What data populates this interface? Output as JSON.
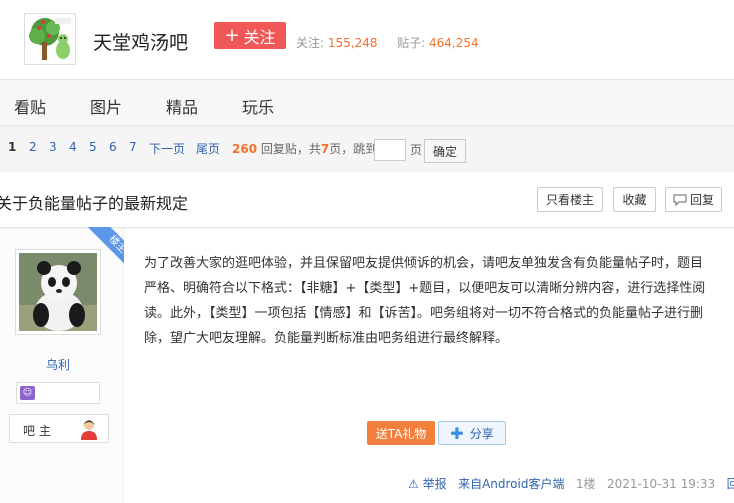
{
  "header": {
    "forum_name": "天堂鸡汤吧",
    "follow_label": "关注",
    "follow_prefix": "+",
    "followers_label": "关注:",
    "followers_count": "155,248",
    "posts_label": "贴子:",
    "posts_count": "464,254"
  },
  "nav": {
    "tabs": [
      {
        "label": "看贴"
      },
      {
        "label": "图片"
      },
      {
        "label": "精品"
      },
      {
        "label": "玩乐"
      }
    ]
  },
  "pager": {
    "pages": [
      "1",
      "2",
      "3",
      "4",
      "5",
      "6",
      "7"
    ],
    "current": "1",
    "next_label": "下一页",
    "last_label": "尾页",
    "reply_count": "260",
    "reply_suffix": "回复贴，共",
    "total_pages": "7",
    "pages_suffix": "页，跳到",
    "page_unit": "页",
    "confirm_label": "确定"
  },
  "thread": {
    "title": "关于负能量帖子的最新规定",
    "only_owner_label": "只看楼主",
    "collect_label": "收藏",
    "reply_label": "回复"
  },
  "post": {
    "author_tag": "楼主",
    "username": "乌利",
    "badge_text": "吧主",
    "content": "为了改善大家的逛吧体验，并且保留吧友提供倾诉的机会，请吧友单独发含有负能量帖子时，题目严格、明确符合以下格式：【非糖】+【类型】+题目，以便吧友可以清晰分辨内容，进行选择性阅读。此外，【类型】一项包括【情感】和【诉苦】。吧务组将对一切不符合格式的负能量帖子进行删除，望广大吧友理解。负能量判断标准由吧务组进行最终解释。",
    "gift_label": "送TA礼物",
    "share_label": "分享",
    "report_label": "举报",
    "source": "来自Android客户端",
    "floor": "1楼",
    "timestamp": "2021-10-31 19:33",
    "reply_label": "回复"
  },
  "colors": {
    "follow_button": "#ef5857",
    "link_blue": "#3163b0",
    "highlight_orange": "#f7702a",
    "author_ribbon": "#5b96e9",
    "gift_button": "#f37f3c"
  },
  "icons": {
    "logo": "tree-logo-icon",
    "share": "plus-icon",
    "report": "warning-icon",
    "reply": "comment-icon",
    "badge": "member-badge-icon",
    "owner": "owner-avatar-icon"
  }
}
